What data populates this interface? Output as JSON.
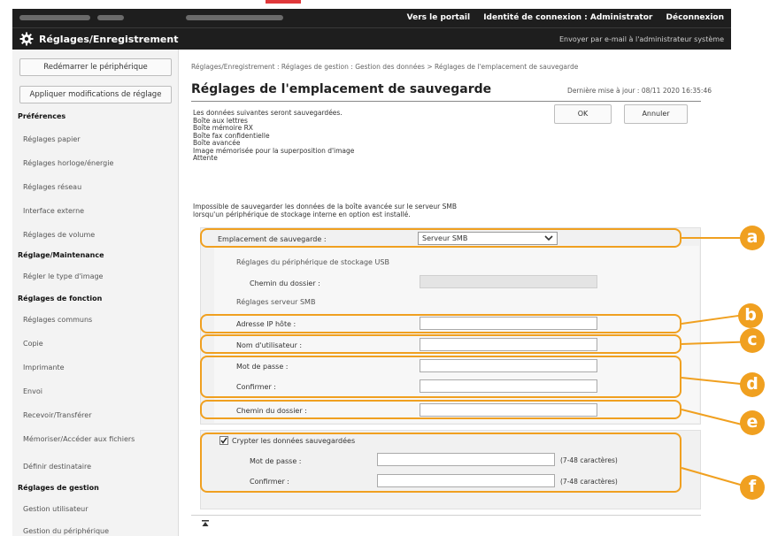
{
  "header": {
    "top_links": [
      "Vers le portail",
      "Identité de connexion : Administrator",
      "Déconnexion"
    ],
    "app_title": "Réglages/Enregistrement",
    "mail_admin": "Envoyer par e-mail à l'administrateur système",
    "gear_icon": "gear-icon"
  },
  "sidebar": {
    "restart_button": "Redémarrer le périphérique",
    "apply_button": "Appliquer modifications de réglage",
    "sections": [
      {
        "heading": "Préférences",
        "items": [
          "Réglages papier",
          "Réglages horloge/énergie",
          "Réglages réseau",
          "Interface externe",
          "Réglages de volume"
        ]
      },
      {
        "heading": "Réglage/Maintenance",
        "items": [
          "Régler le type d'image"
        ]
      },
      {
        "heading": "Réglages de fonction",
        "items": [
          "Réglages communs",
          "Copie",
          "Imprimante",
          "Envoi",
          "Recevoir/Transférer",
          "Mémoriser/Accéder aux fichiers",
          "Définir destinataire"
        ]
      },
      {
        "heading": "Réglages de gestion",
        "items": [
          "Gestion utilisateur",
          "Gestion du périphérique"
        ]
      }
    ]
  },
  "main": {
    "breadcrumb": "Réglages/Enregistrement : Réglages de gestion : Gestion des données > Réglages de l'emplacement de sauvegarde",
    "title": "Réglages de l'emplacement de sauvegarde",
    "last_update": "Dernière mise à jour : 08/11 2020 16:35:46",
    "ok_button": "OK",
    "cancel_button": "Annuler",
    "info_lines": [
      "Les données suivantes seront sauvegardées.",
      "Boîte aux lettres",
      "Boîte mémoire RX",
      "Boîte fax confidentielle",
      "Boîte avancée",
      "Image mémorisée pour la superposition d'image",
      "Attente"
    ],
    "note_lines": [
      "Impossible de sauvegarder les données de la boîte avancée sur le serveur SMB",
      "lorsqu'un périphérique de stockage interne en option est installé."
    ],
    "location_label": "Emplacement de sauvegarde :",
    "location_value": "Serveur SMB",
    "usb_heading": "Réglages du périphérique de stockage USB",
    "usb_folder_label": "Chemin du dossier :",
    "smb_heading": "Réglages serveur SMB",
    "smb_host_label": "Adresse IP hôte :",
    "smb_user_label": "Nom d'utilisateur :",
    "smb_password_label": "Mot de passe :",
    "smb_confirm_label": "Confirmer :",
    "smb_folder_label": "Chemin du dossier :",
    "encrypt_label": "Crypter les données sauvegardées",
    "encrypt_checked": true,
    "enc_password_label": "Mot de passe :",
    "enc_confirm_label": "Confirmer :",
    "enc_hint_1": "(7-48 caractères)",
    "enc_hint_2": "(7-48 caractères)"
  },
  "callouts": [
    "a",
    "b",
    "c",
    "d",
    "e",
    "f"
  ],
  "colors": {
    "header_bg": "#1e1e1e",
    "callout": "#f0a020",
    "accent_red": "#e0383a"
  }
}
